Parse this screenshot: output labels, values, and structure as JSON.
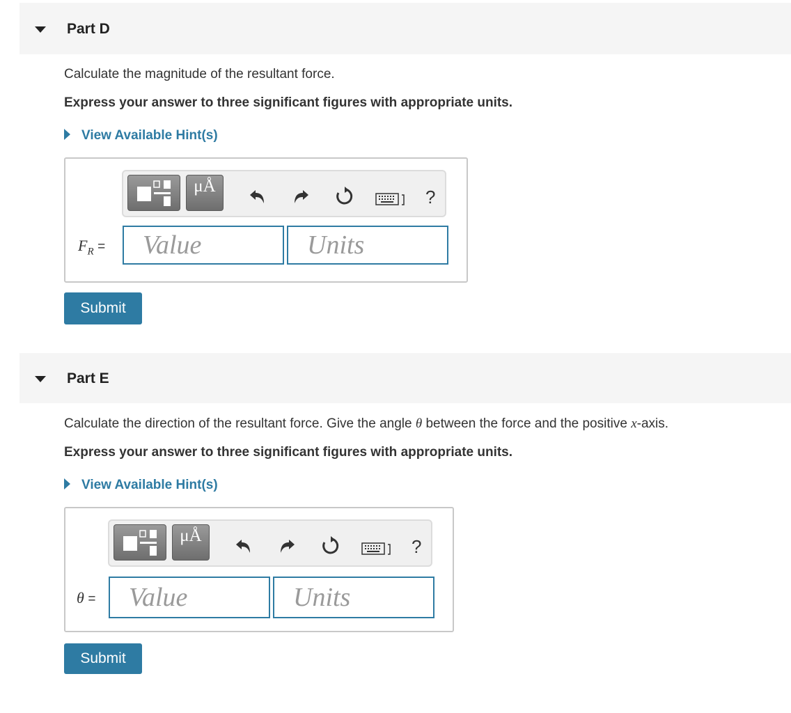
{
  "parts": [
    {
      "title": "Part D",
      "question": "Calculate the magnitude of the resultant force.",
      "instruction": "Express your answer to three significant figures with appropriate units.",
      "hint_label": "View Available Hint(s)",
      "variable_main": "F",
      "variable_sub": "R",
      "equals": "=",
      "value_placeholder": "Value",
      "units_placeholder": "Units",
      "submit_label": "Submit",
      "toolbar": {
        "units_label": "μÅ",
        "help_label": "?"
      }
    },
    {
      "title": "Part E",
      "question_before": "Calculate the direction of the resultant force. Give the angle ",
      "question_theta": "θ",
      "question_middle": " between the force and the positive ",
      "question_x": "x",
      "question_after": "-axis.",
      "instruction": "Express your answer to three significant figures with appropriate units.",
      "hint_label": "View Available Hint(s)",
      "variable_main": "θ",
      "equals": "=",
      "value_placeholder": "Value",
      "units_placeholder": "Units",
      "submit_label": "Submit",
      "toolbar": {
        "units_label": "μÅ",
        "help_label": "?"
      }
    }
  ]
}
